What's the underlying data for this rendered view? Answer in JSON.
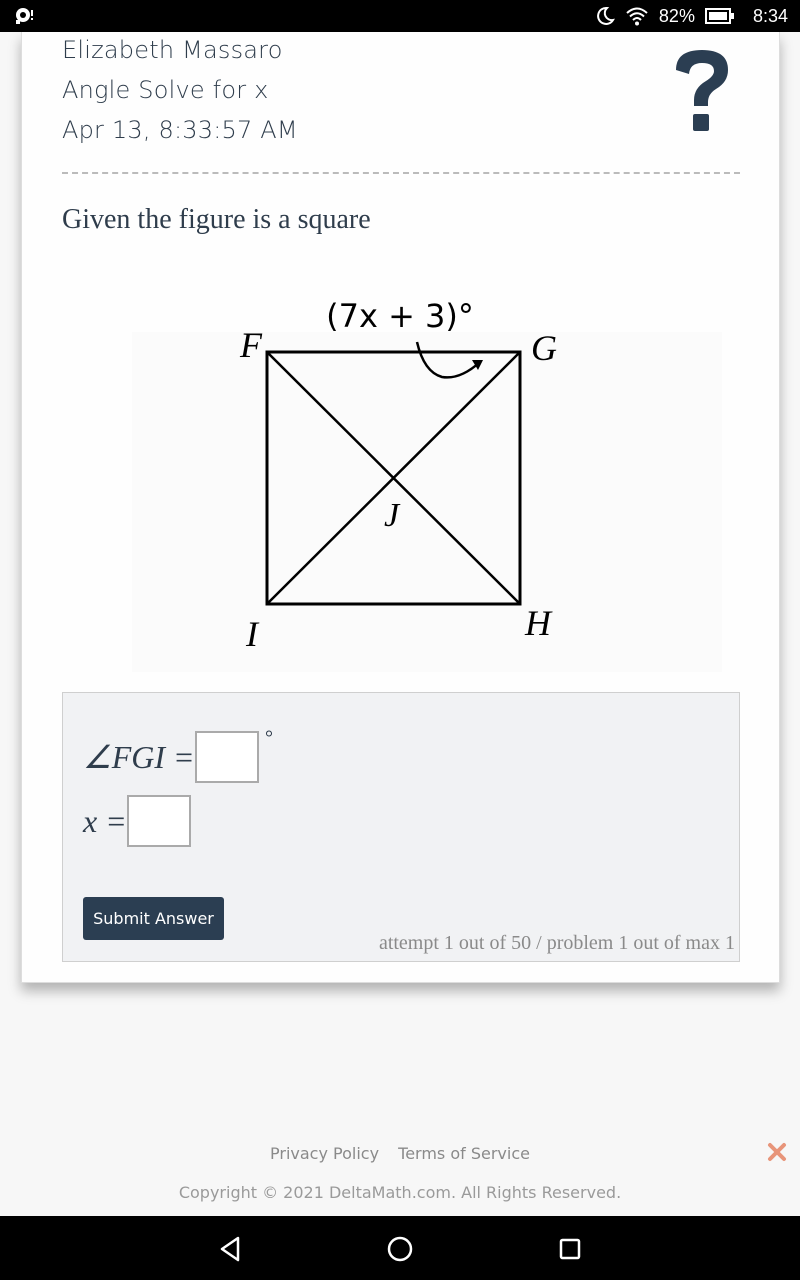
{
  "status_bar": {
    "battery": "82%",
    "time": "8:34",
    "icons": [
      "notification-icon",
      "do-not-disturb-moon-icon",
      "wifi-icon",
      "battery-icon"
    ]
  },
  "header": {
    "student_name": "Elizabeth Massaro",
    "assignment": "Angle Solve for x",
    "timestamp": "Apr 13, 8:33:57 AM",
    "help_icon": "question-mark-icon"
  },
  "problem": {
    "prompt": "Given the figure is a square",
    "figure": {
      "angle_label": "(7x + 3)°",
      "vertices": [
        "F",
        "G",
        "H",
        "I"
      ],
      "center_label": "J"
    }
  },
  "answers": {
    "rows": [
      {
        "label": "∠FGI",
        "equals": "=",
        "value": "",
        "unit": "°"
      },
      {
        "label": "x",
        "equals": "=",
        "value": "",
        "unit": ""
      }
    ],
    "submit_label": "Submit Answer",
    "attempt_text": "attempt 1 out of 50 / problem 1 out of max 1"
  },
  "footer": {
    "links": [
      "Privacy Policy",
      "Terms of Service"
    ],
    "copyright": "Copyright © 2021 DeltaMath.com. All Rights Reserved.",
    "close_color": "#e8957a"
  },
  "nav_bar": {
    "buttons": [
      "back-icon",
      "home-icon",
      "recents-icon"
    ]
  }
}
